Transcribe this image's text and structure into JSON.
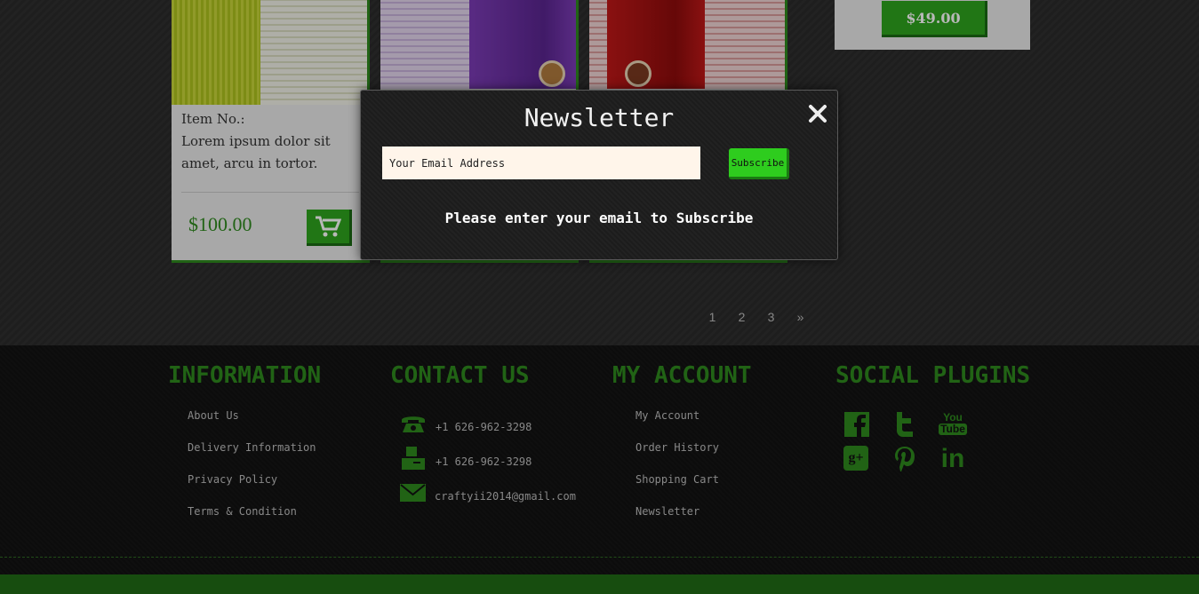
{
  "products": [
    {
      "item_label": "Item No.:",
      "description": "Lorem ipsum dolor sit amet, arcu in tortor.",
      "price": "$100.00"
    }
  ],
  "side_product": {
    "price": "$49.00"
  },
  "pagination": {
    "pages": [
      "1",
      "2",
      "3"
    ],
    "next": "»"
  },
  "footer": {
    "information": {
      "heading": "INFORMATION",
      "links": [
        "About Us",
        "Delivery Information",
        "Privacy Policy",
        "Terms & Condition"
      ]
    },
    "contact": {
      "heading": "CONTACT US",
      "phone": "+1 626-962-3298",
      "fax": "+1 626-962-3298",
      "email": "craftyii2014@gmail.com"
    },
    "account": {
      "heading": "MY ACCOUNT",
      "links": [
        "My Account",
        "Order History",
        "Shopping Cart",
        "Newsletter"
      ]
    },
    "social": {
      "heading": "SOCIAL PLUGINS",
      "icons": [
        "facebook-icon",
        "twitter-icon",
        "youtube-icon",
        "google-plus-icon",
        "pinterest-icon",
        "linkedin-icon"
      ],
      "youtube_text": [
        "You",
        "Tube"
      ],
      "google_text": "g+",
      "linkedin_text": "in"
    }
  },
  "newsletter_modal": {
    "title": "Newsletter",
    "email_placeholder": "Your Email Address",
    "subscribe_label": "Subscribe",
    "message": "Please enter your email to Subscribe"
  },
  "colors": {
    "accent": "#2e8a1e",
    "button": "#2ea41e",
    "subscribe": "#2ecc1e"
  }
}
